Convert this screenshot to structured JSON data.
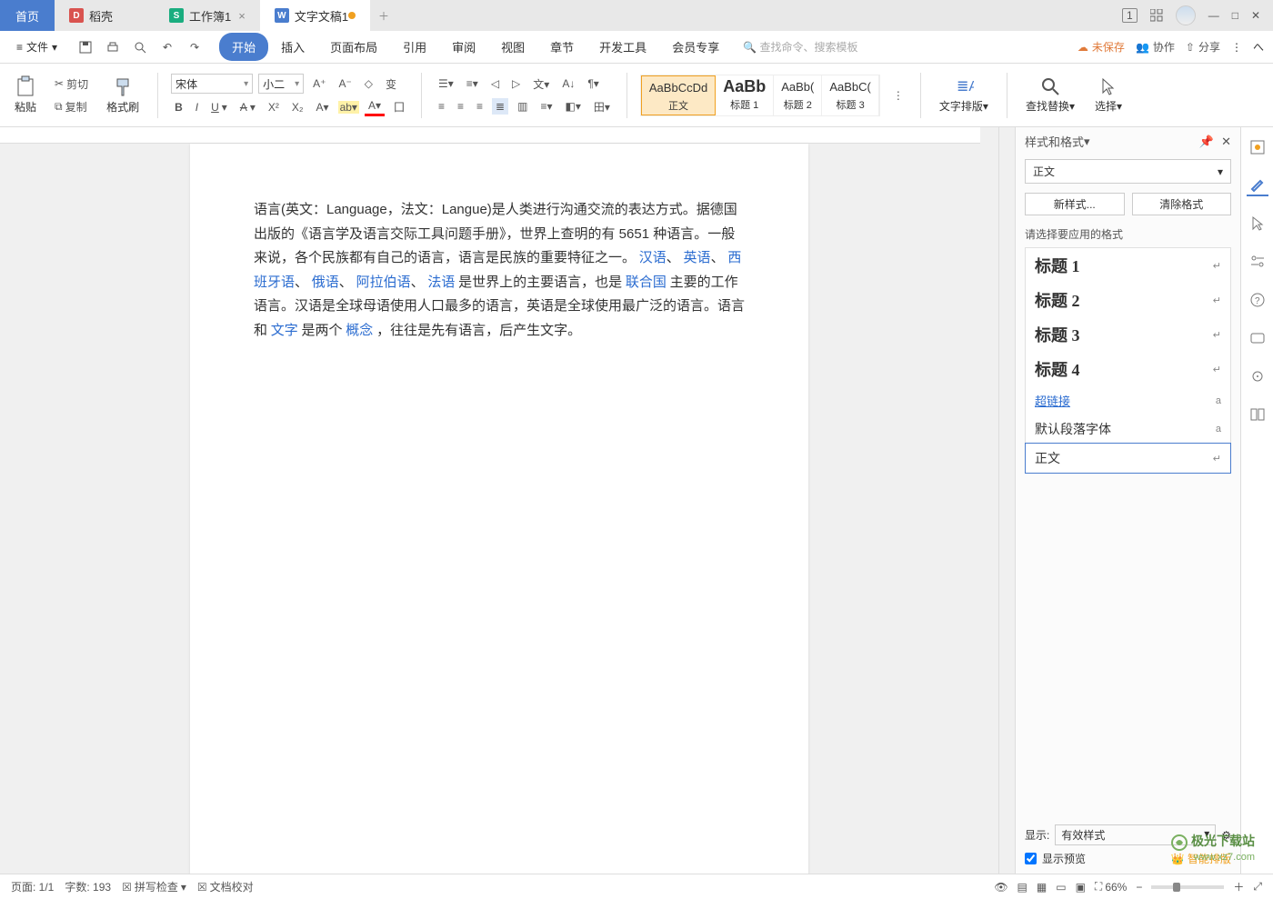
{
  "titletabs": {
    "home": "首页",
    "wps": "稻壳",
    "sheet": "工作簿1",
    "doc": "文字文稿1"
  },
  "winctrl": {
    "num": "1"
  },
  "menubar": {
    "file": "文件",
    "tabs": [
      "开始",
      "插入",
      "页面布局",
      "引用",
      "审阅",
      "视图",
      "章节",
      "开发工具",
      "会员专享"
    ],
    "search_placeholder": "查找命令、搜索模板",
    "unsaved": "未保存",
    "collab": "协作",
    "share": "分享"
  },
  "ribbon": {
    "paste": "粘贴",
    "cut": "剪切",
    "copy": "复制",
    "fmt": "格式刷",
    "font_name": "宋体",
    "font_size": "小二",
    "styles": {
      "body_prev": "AaBbCcDd",
      "body": "正文",
      "h1_prev": "AaBb",
      "h1": "标题 1",
      "h2_prev": "AaBb(",
      "h2": "标题 2",
      "h3_prev": "AaBbC(",
      "h3": "标题 3"
    },
    "text_layout": "文字排版",
    "find_replace": "查找替换",
    "select": "选择"
  },
  "document": {
    "p1a": "语言(英文：Language，法文：Langue)是人类进行沟通交流的表达方式。据德国出版的《语言学及语言交际工具问题手册》，世界上查明的有 5651 种语言。一般来说，各个民族都有自己的语言，语言是民族的重要特征之一。",
    "l1": "汉语",
    "s1": "、",
    "l2": "英语",
    "s2": "、",
    "l3": "西班牙语",
    "s3": "、",
    "l4": "俄语",
    "s4": "、",
    "l5": "阿拉伯语",
    "s5": "、",
    "l6": "法语",
    "p1b": "是世界上的主要语言，也是",
    "l7": "联合国",
    "p1c": "主要的工作语言。汉语是全球母语使用人口最多的语言，英语是全球使用最广泛的语言。语言和",
    "l8": "文字",
    "p1d": "是两个",
    "l9": "概念",
    "p1e": "，往往是先有语言，后产生文字。"
  },
  "sidepanel": {
    "title": "样式和格式",
    "current": "正文",
    "new_style": "新样式...",
    "clear_fmt": "清除格式",
    "apply_hint": "请选择要应用的格式",
    "items": [
      {
        "name": "标题 1",
        "cls": "h1",
        "ret": "↵"
      },
      {
        "name": "标题 2",
        "cls": "h2",
        "ret": "↵"
      },
      {
        "name": "标题 3",
        "cls": "h3",
        "ret": "↵"
      },
      {
        "name": "标题 4",
        "cls": "h4",
        "ret": "↵"
      },
      {
        "name": "超链接",
        "cls": "link",
        "ret": "a"
      },
      {
        "name": "默认段落字体",
        "cls": "def",
        "ret": "a"
      },
      {
        "name": "正文",
        "cls": "sel",
        "ret": "↵"
      }
    ],
    "show_label": "显示:",
    "show_value": "有效样式",
    "preview_chk": "显示预览",
    "smart": "智能排版"
  },
  "statusbar": {
    "page": "页面: 1/1",
    "words": "字数: 193",
    "spell": "拼写检查",
    "proof": "文档校对",
    "zoom": "66%"
  },
  "watermark": {
    "l1": "极光下载站",
    "l2": "www.xz7.com"
  }
}
